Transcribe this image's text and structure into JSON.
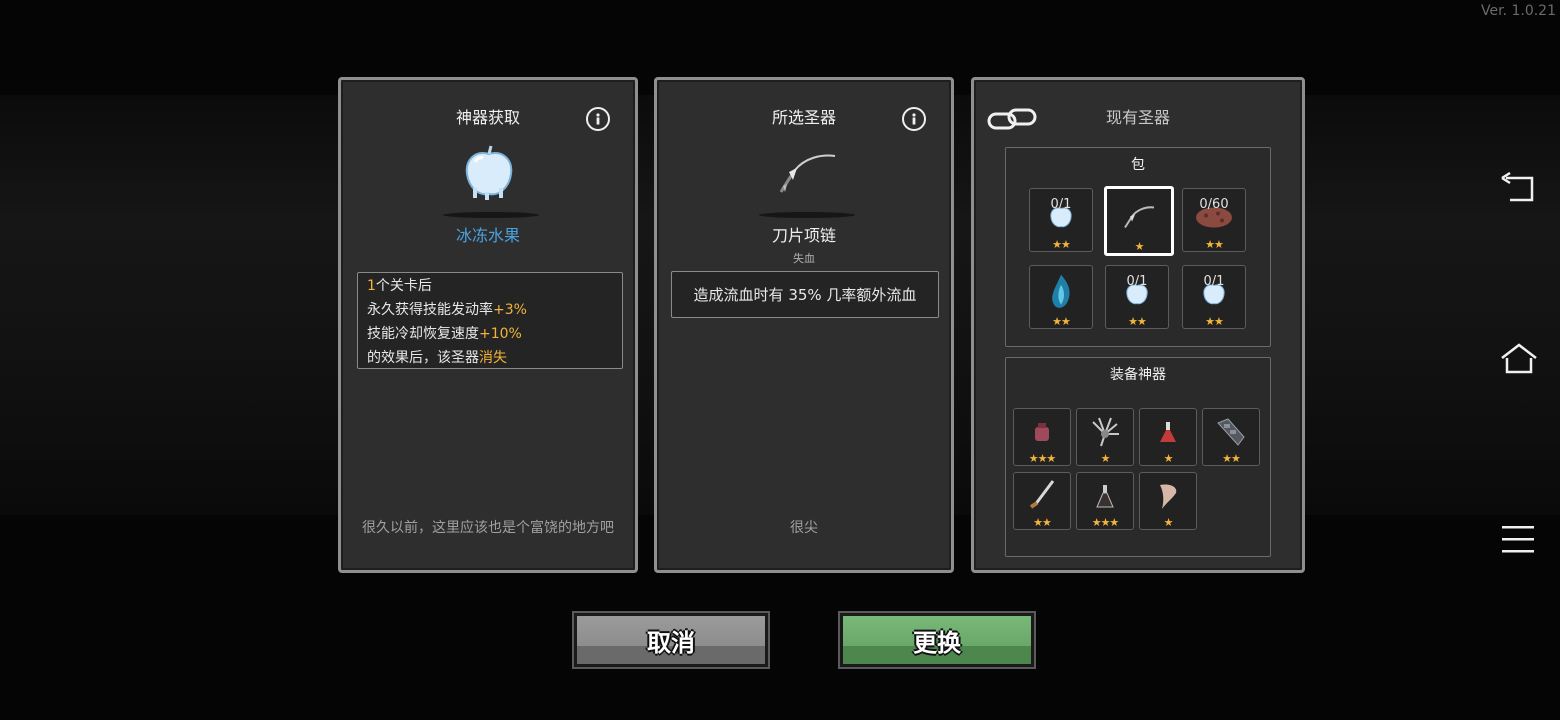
{
  "version": "Ver. 1.0.21",
  "left_panel": {
    "title": "神器获取",
    "item_name": "冰冻水果",
    "item_name_color": "#4aa3df",
    "description_lines": [
      [
        {
          "t": "1",
          "hl": true
        },
        {
          "t": "个关卡后",
          "hl": false
        }
      ],
      [
        {
          "t": "永久获得技能发动率",
          "hl": false
        },
        {
          "t": "+3%",
          "hl": true
        }
      ],
      [
        {
          "t": "技能冷却恢复速度",
          "hl": false
        },
        {
          "t": "+10%",
          "hl": true
        }
      ],
      [
        {
          "t": "的效果后，该圣器",
          "hl": false
        },
        {
          "t": "消失",
          "hl": true
        }
      ]
    ],
    "flavor_text": "很久以前，这里应该也是个富饶的地方吧",
    "info_icon": "info-icon"
  },
  "middle_panel": {
    "title": "所选圣器",
    "item_name": "刀片项链",
    "item_tag": "失血",
    "description": "造成流血时有 35% 几率额外流血",
    "flavor_text": "很尖",
    "info_icon": "info-icon"
  },
  "right_panel": {
    "title": "现有圣器",
    "link_icon": "chain-link-icon",
    "bag": {
      "label": "包",
      "slots": [
        {
          "name": "frozen-fruit-icon",
          "count": "0/1",
          "stars": "★★",
          "selected": false
        },
        {
          "name": "blade-necklace-icon",
          "count": "",
          "stars": "★",
          "selected": true
        },
        {
          "name": "meat-icon",
          "count": "0/60",
          "stars": "★★",
          "selected": false
        },
        {
          "name": "blue-flame-icon",
          "count": "",
          "stars": "★★",
          "selected": false
        },
        {
          "name": "frozen-fruit-icon",
          "count": "0/1",
          "stars": "★★",
          "selected": false
        },
        {
          "name": "frozen-fruit-icon",
          "count": "0/1",
          "stars": "★★",
          "selected": false
        }
      ]
    },
    "equipped": {
      "label": "装备神器",
      "slots": [
        {
          "name": "red-pouch-icon",
          "stars": "★★★"
        },
        {
          "name": "claw-icon",
          "stars": "★"
        },
        {
          "name": "red-potion-icon",
          "stars": "★"
        },
        {
          "name": "gauntlet-icon",
          "stars": "★★"
        },
        {
          "name": "dagger-icon",
          "stars": "★★"
        },
        {
          "name": "dark-potion-icon",
          "stars": "★★★"
        },
        {
          "name": "fang-icon",
          "stars": "★"
        }
      ]
    }
  },
  "buttons": {
    "cancel_label": "取消",
    "confirm_label": "更换"
  },
  "system_nav": {
    "back_icon": "back-icon",
    "home_icon": "home-icon",
    "menu_icon": "menu-icon"
  },
  "colors": {
    "highlight": "#f2b43a",
    "star": "#f2b43a",
    "confirm_green": "#6aa86a",
    "cancel_gray": "#8d8d8d"
  }
}
